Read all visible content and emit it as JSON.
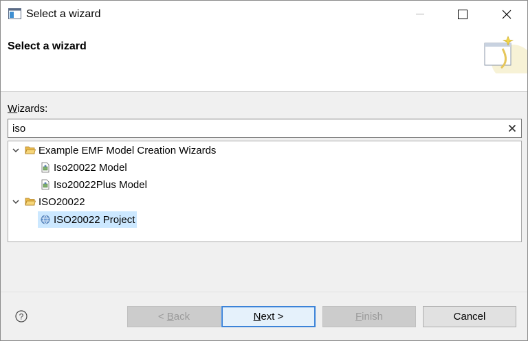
{
  "window": {
    "title": "Select a wizard",
    "controls": {
      "minimize": "minimize",
      "maximize": "maximize",
      "close": "close"
    }
  },
  "banner": {
    "title": "Select a wizard"
  },
  "wizards": {
    "label_mnemonic": "W",
    "label_rest": "izards:",
    "filter_value": "iso",
    "clear_glyph": "✕"
  },
  "tree": {
    "items": [
      {
        "label": "Example EMF Model Creation Wizards",
        "type": "folder",
        "expanded": true,
        "level": 0
      },
      {
        "label": "Iso20022 Model",
        "type": "model-file",
        "level": 1
      },
      {
        "label": "Iso20022Plus Model",
        "type": "model-file",
        "level": 1
      },
      {
        "label": "ISO20022",
        "type": "folder",
        "expanded": true,
        "level": 0
      },
      {
        "label": "ISO20022 Project",
        "type": "project",
        "level": 1,
        "selected": true
      }
    ]
  },
  "footer": {
    "help_glyph": "?",
    "back": {
      "prefix": "< ",
      "mnemonic": "B",
      "rest": "ack",
      "enabled": false
    },
    "next": {
      "mnemonic": "N",
      "rest": "ext >",
      "enabled": true,
      "default": true
    },
    "finish": {
      "mnemonic": "F",
      "rest": "inish",
      "enabled": false
    },
    "cancel": {
      "label": "Cancel",
      "enabled": true
    }
  },
  "colors": {
    "selection": "#cce8ff",
    "default_button_border": "#3c83d8",
    "folder": "#e8b84a"
  }
}
